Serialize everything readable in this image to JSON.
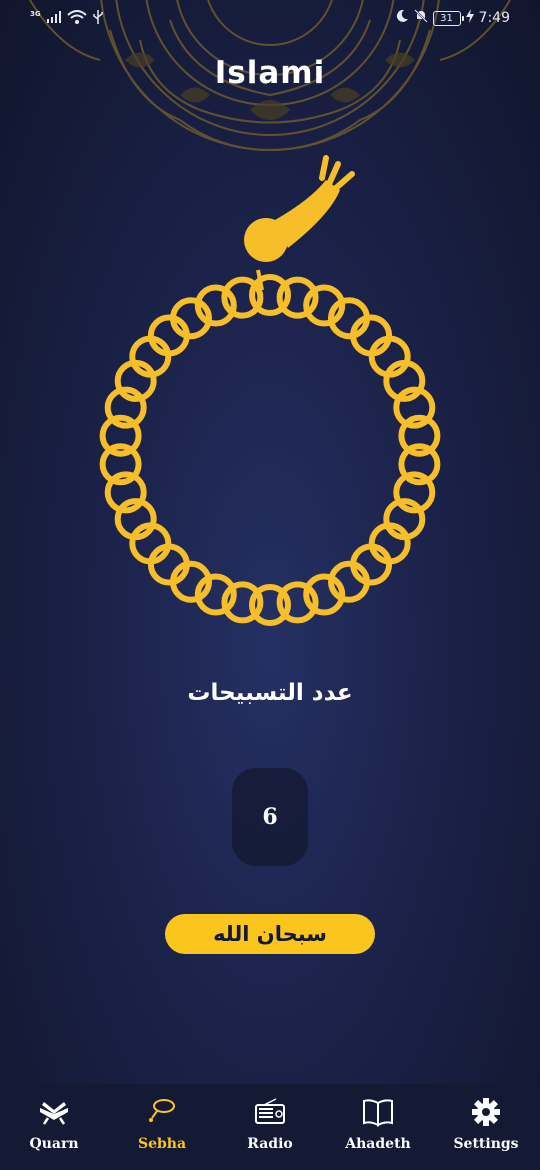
{
  "status_bar": {
    "network_label": "3G",
    "battery_level": "31",
    "time": "7:49"
  },
  "app": {
    "title": "Islami"
  },
  "sebha": {
    "counter_label": "عدد التسبيحات",
    "count": "6",
    "tasbeeh_text": "سبحان الله"
  },
  "bottom_nav": {
    "active": "sebha",
    "items": [
      {
        "key": "quran",
        "label": "Quarn",
        "icon": "quran-book-icon"
      },
      {
        "key": "sebha",
        "label": "Sebha",
        "icon": "sebha-icon"
      },
      {
        "key": "radio",
        "label": "Radio",
        "icon": "radio-icon"
      },
      {
        "key": "ahadeth",
        "label": "Ahadeth",
        "icon": "open-book-icon"
      },
      {
        "key": "settings",
        "label": "Settings",
        "icon": "gear-icon"
      }
    ]
  },
  "colors": {
    "background": "#1b2249",
    "accent": "#fac51c",
    "bead": "#f6bf2a",
    "mandala": "#6d5a2d",
    "nav_background": "#141a33",
    "counter_box": "#141a34"
  }
}
